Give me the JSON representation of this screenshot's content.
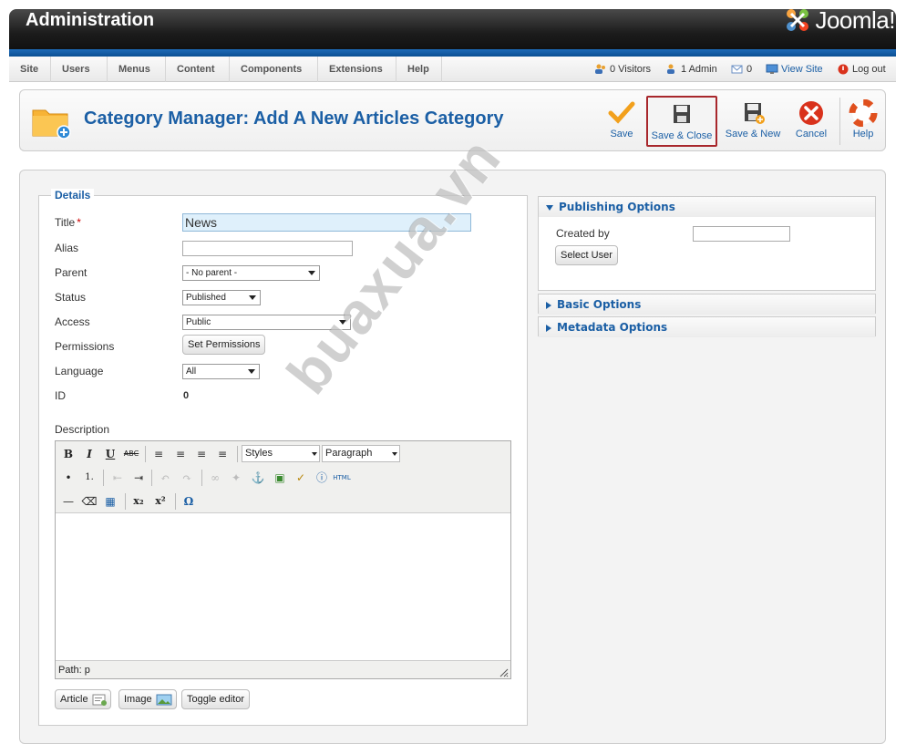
{
  "header": {
    "title": "Administration",
    "logo_text": "Joomla!"
  },
  "menu": {
    "items": [
      "Site",
      "Users",
      "Menus",
      "Content",
      "Components",
      "Extensions",
      "Help"
    ],
    "status": {
      "visitors": "0 Visitors",
      "admins": "1 Admin",
      "messages": "0",
      "view_site": "View Site",
      "logout": "Log out"
    }
  },
  "toolbar": {
    "page_title": "Category Manager: Add A New Articles Category",
    "buttons": {
      "save": "Save",
      "save_close": "Save & Close",
      "save_new": "Save & New",
      "cancel": "Cancel",
      "help": "Help"
    }
  },
  "details": {
    "legend": "Details",
    "title_label": "Title",
    "required_mark": "*",
    "title_value": "News",
    "alias_label": "Alias",
    "alias_value": "",
    "parent_label": "Parent",
    "parent_value": "- No parent -",
    "status_label": "Status",
    "status_value": "Published",
    "access_label": "Access",
    "access_value": "Public",
    "permissions_label": "Permissions",
    "permissions_button": "Set Permissions",
    "language_label": "Language",
    "language_value": "All",
    "id_label": "ID",
    "id_value": "0",
    "description_label": "Description"
  },
  "editor": {
    "styles_value": "Styles",
    "format_value": "Paragraph",
    "path_text": "Path: p",
    "buttons": {
      "article": "Article",
      "image": "Image",
      "toggle": "Toggle editor"
    }
  },
  "publishing": {
    "title": "Publishing Options",
    "created_by_label": "Created by",
    "created_by_value": "",
    "select_user_button": "Select User"
  },
  "basic_options": {
    "title": "Basic Options"
  },
  "metadata_options": {
    "title": "Metadata Options"
  },
  "watermark": "buaxua.vn",
  "colors": {
    "accent": "#1b5fa5",
    "header_bg": "#1c1c1c",
    "highlight_border": "#a8272c",
    "title_input_bg": "#dff0fb"
  }
}
